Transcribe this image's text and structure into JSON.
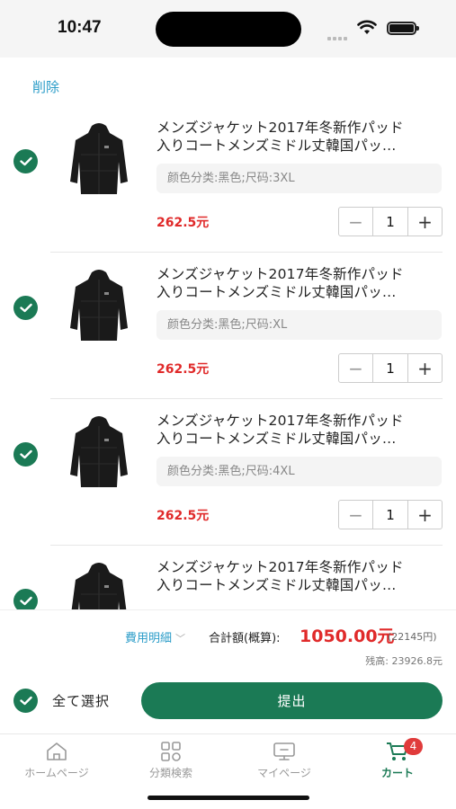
{
  "status_bar": {
    "time": "10:47"
  },
  "header": {
    "delete_label": "削除"
  },
  "cart_items": [
    {
      "title_line1": "メンズジャケット2017年冬新作パッド",
      "title_line2": "入りコートメンズミドル丈韓国パッ…",
      "spec": "颜色分类:黑色;尺码:3XL",
      "price": "262.5元",
      "quantity": "1"
    },
    {
      "title_line1": "メンズジャケット2017年冬新作パッド",
      "title_line2": "入りコートメンズミドル丈韓国パッ…",
      "spec": "颜色分类:黑色;尺码:XL",
      "price": "262.5元",
      "quantity": "1"
    },
    {
      "title_line1": "メンズジャケット2017年冬新作パッド",
      "title_line2": "入りコートメンズミドル丈韓国パッ…",
      "spec": "颜色分类:黑色;尺码:4XL",
      "price": "262.5元",
      "quantity": "1"
    },
    {
      "title_line1": "メンズジャケット2017年冬新作パッド",
      "title_line2": "入りコートメンズミドル丈韓国パッ…",
      "spec": "",
      "price": "",
      "quantity": ""
    }
  ],
  "summary": {
    "fee_detail_label": "費用明細",
    "total_label": "合計額(概算):",
    "total_amount": "1050.00元",
    "total_yen": "(22145円)",
    "balance": "残高: 23926.8元",
    "select_all_label": "全て選択",
    "submit_label": "提出"
  },
  "tab_bar": {
    "tabs": [
      {
        "label": "ホームページ",
        "icon": "home-icon"
      },
      {
        "label": "分類検索",
        "icon": "category-grid-icon"
      },
      {
        "label": "マイページ",
        "icon": "my-page-icon"
      },
      {
        "label": "カート",
        "icon": "cart-icon"
      }
    ],
    "cart_badge": "4"
  },
  "colors": {
    "accent_green": "#1b7a55",
    "price_red": "#e02a2a",
    "link_blue": "#2a9cc8"
  }
}
